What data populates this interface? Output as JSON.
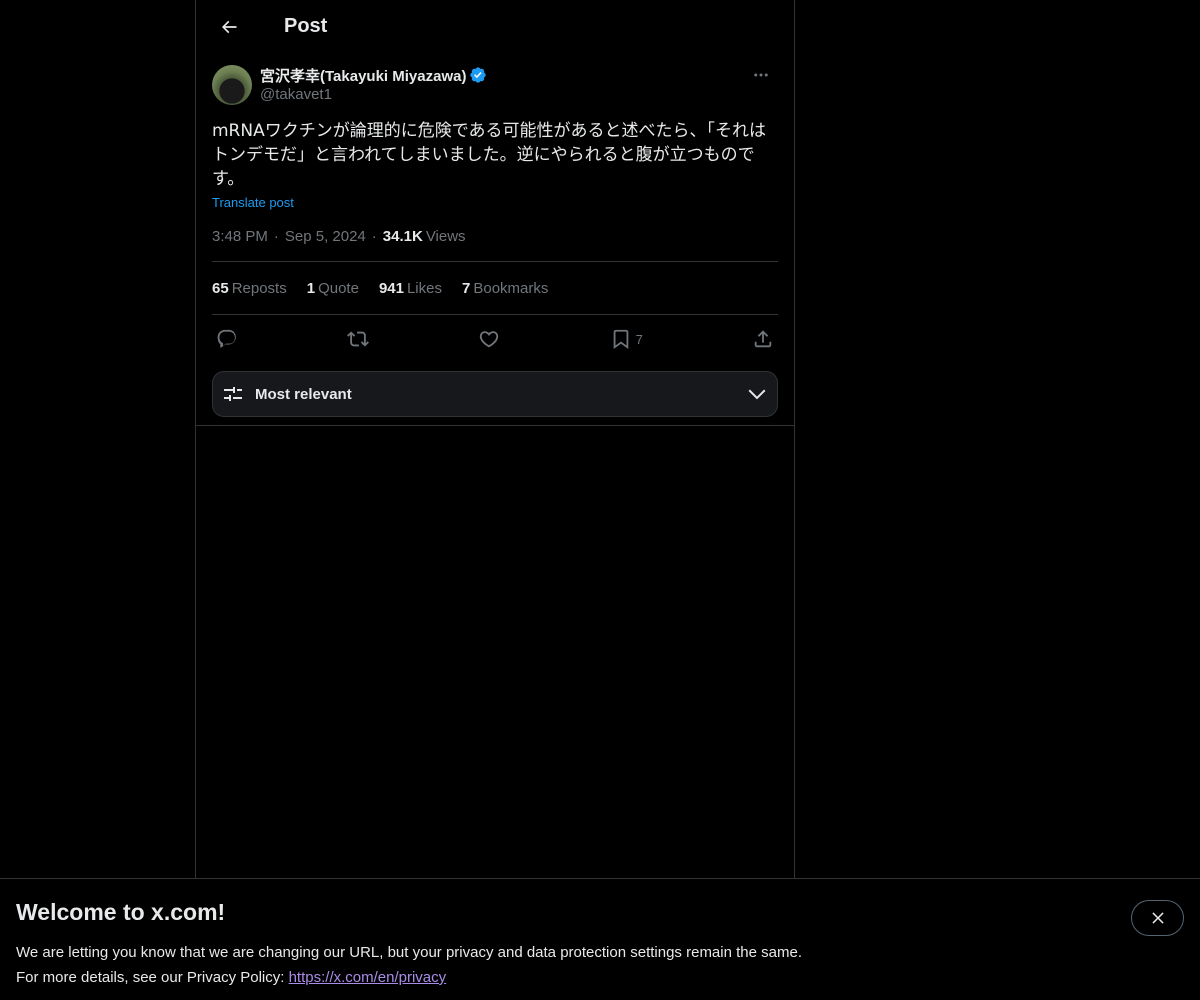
{
  "header": {
    "title": "Post",
    "back_icon": "arrow-left-icon"
  },
  "post": {
    "author": {
      "display_name": "宮沢孝幸(Takayuki Miyazawa)",
      "handle": "@takavet1",
      "verified_color": "#1d9bf0"
    },
    "text": "mRNAワクチンが論理的に危険である可能性があると述べたら、「それは\nトンデモだ」と言われてしまいました。逆にやられると腹が立つもので\nす。",
    "translate_label": "Translate post",
    "time": "3:48 PM",
    "date": "Sep 5, 2024",
    "views_count": "34.1K",
    "views_label": "Views",
    "stats": {
      "reposts_count": "65",
      "reposts_label": "Reposts",
      "quote_count": "1",
      "quote_label": "Quote",
      "likes_count": "941",
      "likes_label": "Likes",
      "bookmarks_count": "7",
      "bookmarks_label": "Bookmarks"
    },
    "actions": {
      "bookmark_count": "7"
    }
  },
  "sort": {
    "label": "Most relevant"
  },
  "banner": {
    "title": "Welcome to x.com!",
    "line1": "We are letting you know that we are changing our URL, but your privacy and data protection settings remain the same.",
    "line2_prefix": "For more details, see our Privacy Policy: ",
    "link": "https://x.com/en/privacy"
  },
  "colors": {
    "background": "#000000",
    "accent": "#1d9bf0",
    "border": "#2f3336",
    "muted_text": "#71767b",
    "link_visited": "#a98ce8"
  }
}
